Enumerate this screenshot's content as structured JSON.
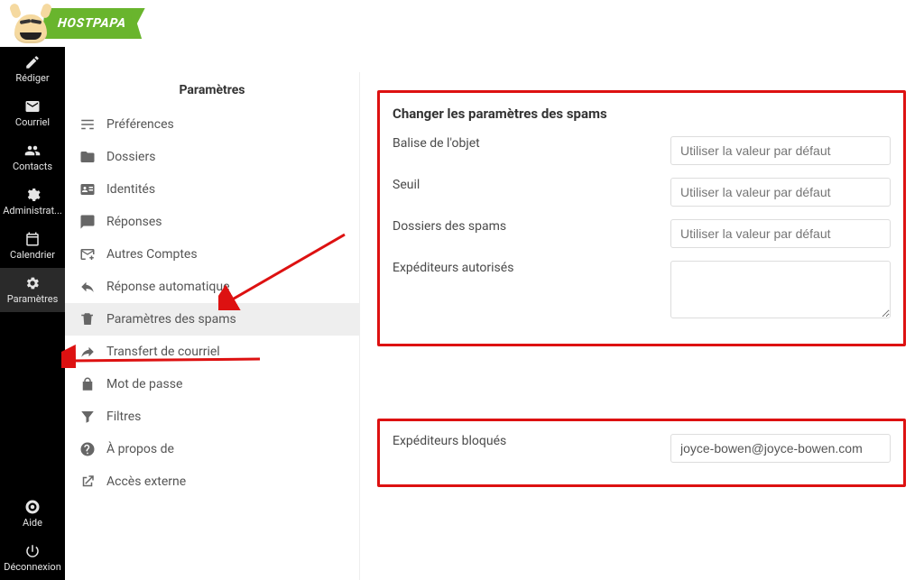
{
  "brand": {
    "name": "HOSTPAPA"
  },
  "rail": {
    "items": [
      {
        "key": "compose",
        "label": "Rédiger"
      },
      {
        "key": "mail",
        "label": "Courriel"
      },
      {
        "key": "contacts",
        "label": "Contacts"
      },
      {
        "key": "admin",
        "label": "Administrat..."
      },
      {
        "key": "calendar",
        "label": "Calendrier"
      },
      {
        "key": "settings",
        "label": "Paramètres",
        "active": true
      },
      {
        "key": "help",
        "label": "Aide"
      },
      {
        "key": "logout",
        "label": "Déconnexion"
      }
    ]
  },
  "settings": {
    "title": "Paramètres",
    "items": [
      {
        "key": "prefs",
        "label": "Préférences"
      },
      {
        "key": "folders",
        "label": "Dossiers"
      },
      {
        "key": "identities",
        "label": "Identités"
      },
      {
        "key": "responses",
        "label": "Réponses"
      },
      {
        "key": "accounts",
        "label": "Autres Comptes"
      },
      {
        "key": "autoresp",
        "label": "Réponse automatique"
      },
      {
        "key": "spam",
        "label": "Paramètres des spams",
        "active": true
      },
      {
        "key": "forward",
        "label": "Transfert de courriel"
      },
      {
        "key": "password",
        "label": "Mot de passe"
      },
      {
        "key": "filters",
        "label": "Filtres"
      },
      {
        "key": "about",
        "label": "À propos de"
      },
      {
        "key": "external",
        "label": "Accès externe"
      }
    ]
  },
  "spam": {
    "heading": "Changer les paramètres des spams",
    "subject_tag_label": "Balise de l'objet",
    "subject_tag_placeholder": "Utiliser la valeur par défaut",
    "threshold_label": "Seuil",
    "threshold_placeholder": "Utiliser la valeur par défaut",
    "spam_folder_label": "Dossiers des spams",
    "spam_folder_placeholder": "Utiliser la valeur par défaut",
    "allowed_label": "Expéditeurs autorisés",
    "allowed_value": "",
    "blocked_label": "Expéditeurs bloqués",
    "blocked_value": "joyce-bowen@joyce-bowen.com"
  },
  "annotations": {
    "arrow_color": "#d11"
  }
}
